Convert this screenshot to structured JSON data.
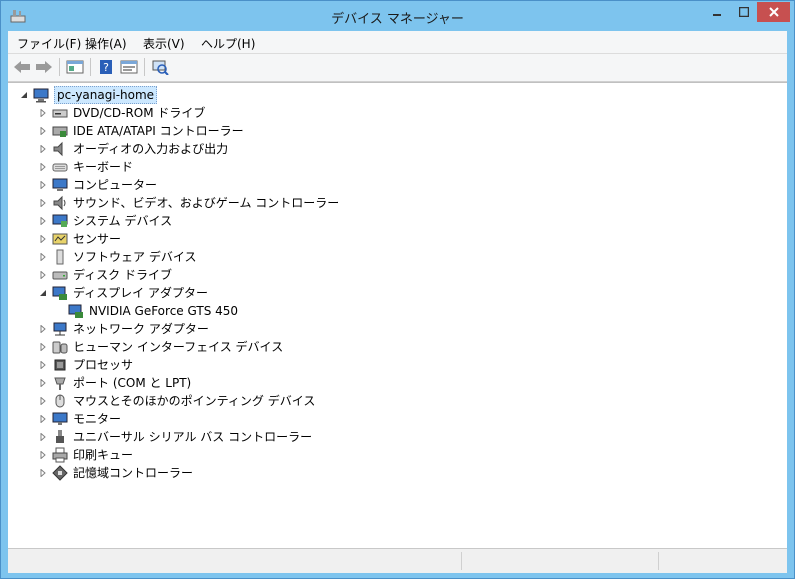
{
  "window": {
    "title": "デバイス マネージャー"
  },
  "menu": [
    {
      "label": "ファイル(F)"
    },
    {
      "label": "操作(A)"
    },
    {
      "label": "表示(V)"
    },
    {
      "label": "ヘルプ(H)"
    }
  ],
  "tree": {
    "root": "pc-yanagi-home",
    "items": [
      {
        "label": "DVD/CD-ROM ドライブ",
        "icon": "dvd-drive-icon"
      },
      {
        "label": "IDE ATA/ATAPI コントローラー",
        "icon": "ide-controller-icon"
      },
      {
        "label": "オーディオの入力および出力",
        "icon": "speaker-icon"
      },
      {
        "label": "キーボード",
        "icon": "keyboard-icon"
      },
      {
        "label": "コンピューター",
        "icon": "computer-icon"
      },
      {
        "label": "サウンド、ビデオ、およびゲーム コントローラー",
        "icon": "sound-icon"
      },
      {
        "label": "システム デバイス",
        "icon": "system-device-icon"
      },
      {
        "label": "センサー",
        "icon": "sensor-icon"
      },
      {
        "label": "ソフトウェア デバイス",
        "icon": "software-device-icon"
      },
      {
        "label": "ディスク ドライブ",
        "icon": "disk-drive-icon"
      },
      {
        "label": "ディスプレイ アダプター",
        "icon": "display-adapter-icon",
        "expanded": true
      },
      {
        "label": "NVIDIA GeForce GTS 450",
        "icon": "display-adapter-icon",
        "child": true
      },
      {
        "label": "ネットワーク アダプター",
        "icon": "network-adapter-icon"
      },
      {
        "label": "ヒューマン インターフェイス デバイス",
        "icon": "hid-icon"
      },
      {
        "label": "プロセッサ",
        "icon": "processor-icon"
      },
      {
        "label": "ポート (COM と LPT)",
        "icon": "port-icon"
      },
      {
        "label": "マウスとそのほかのポインティング デバイス",
        "icon": "mouse-icon"
      },
      {
        "label": "モニター",
        "icon": "monitor-icon"
      },
      {
        "label": "ユニバーサル シリアル バス コントローラー",
        "icon": "usb-icon"
      },
      {
        "label": "印刷キュー",
        "icon": "printer-icon"
      },
      {
        "label": "記憶域コントローラー",
        "icon": "storage-controller-icon"
      }
    ]
  }
}
